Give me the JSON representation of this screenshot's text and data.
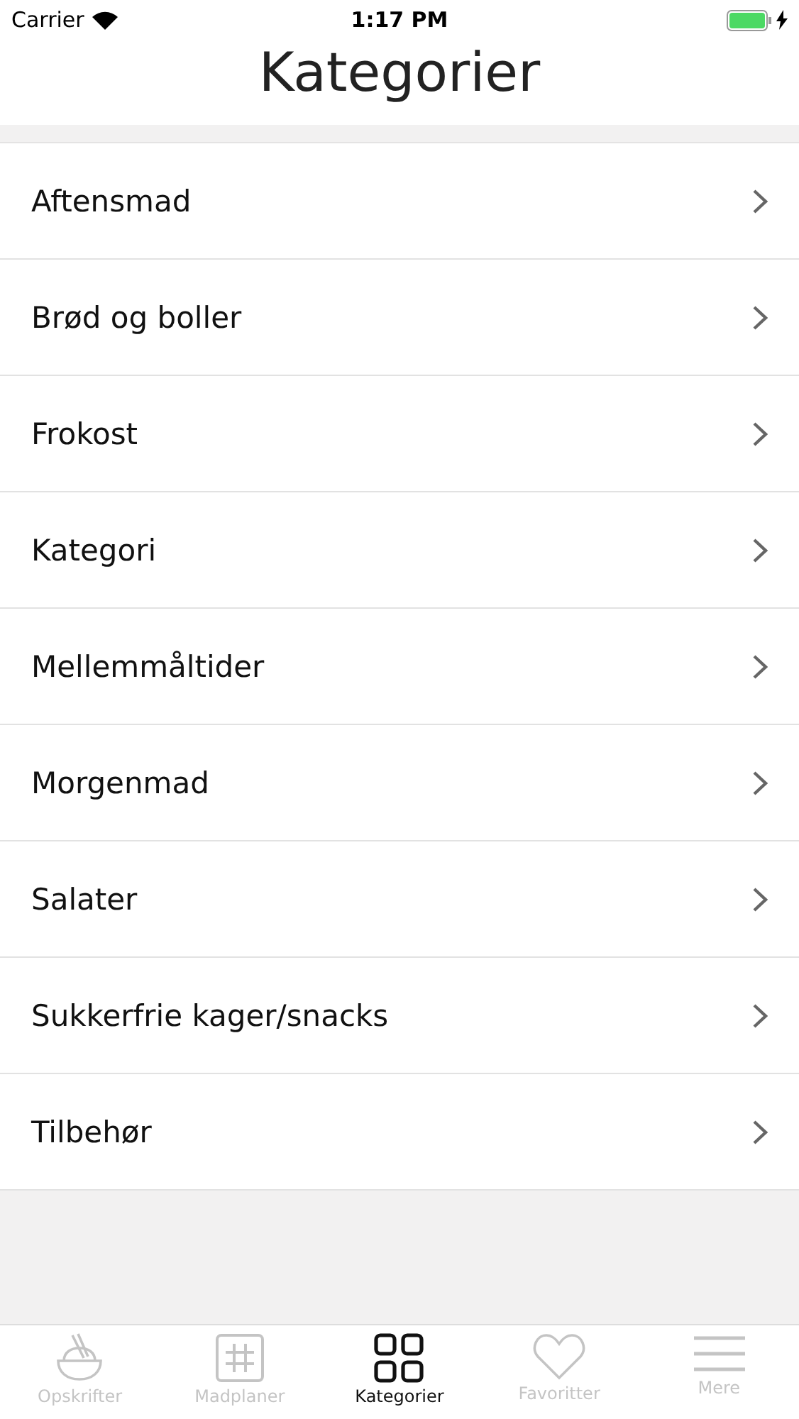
{
  "status_bar": {
    "carrier": "Carrier",
    "time": "1:17 PM"
  },
  "title": "Kategorier",
  "categories": [
    "Aftensmad",
    "Brød og boller",
    "Frokost",
    "Kategori",
    "Mellemmåltider",
    "Morgenmad",
    "Salater",
    "Sukkerfrie kager/snacks",
    "Tilbehør"
  ],
  "tab_bar": [
    {
      "label": "Opskrifter",
      "kind": "bowl",
      "selected": false
    },
    {
      "label": "Madplaner",
      "kind": "grid",
      "selected": false
    },
    {
      "label": "Kategorier",
      "kind": "squares",
      "selected": true
    },
    {
      "label": "Favoritter",
      "kind": "heart",
      "selected": false
    },
    {
      "label": "Mere",
      "kind": "menu",
      "selected": false
    }
  ]
}
